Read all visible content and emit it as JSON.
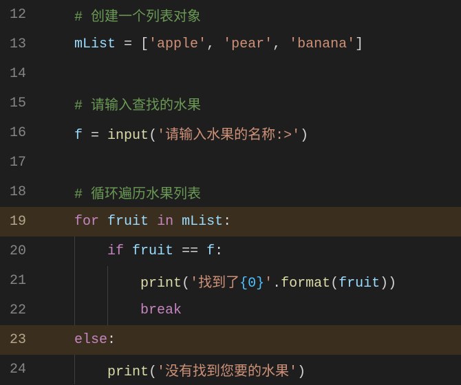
{
  "lines": [
    {
      "num": "12",
      "hl": false,
      "indent": "    ",
      "guides": [],
      "tokens": [
        {
          "t": "# 创建一个列表对象",
          "c": "c-comment"
        }
      ]
    },
    {
      "num": "13",
      "hl": false,
      "indent": "    ",
      "guides": [],
      "tokens": [
        {
          "t": "mList",
          "c": "c-var"
        },
        {
          "t": " = [",
          "c": "c-punc"
        },
        {
          "t": "'apple'",
          "c": "c-string"
        },
        {
          "t": ", ",
          "c": "c-punc"
        },
        {
          "t": "'pear'",
          "c": "c-string"
        },
        {
          "t": ", ",
          "c": "c-punc"
        },
        {
          "t": "'banana'",
          "c": "c-string"
        },
        {
          "t": "]",
          "c": "c-punc"
        }
      ]
    },
    {
      "num": "14",
      "hl": false,
      "indent": "",
      "guides": [],
      "tokens": []
    },
    {
      "num": "15",
      "hl": false,
      "indent": "    ",
      "guides": [],
      "tokens": [
        {
          "t": "# 请输入查找的水果",
          "c": "c-comment"
        }
      ]
    },
    {
      "num": "16",
      "hl": false,
      "indent": "    ",
      "guides": [],
      "tokens": [
        {
          "t": "f",
          "c": "c-var"
        },
        {
          "t": " = ",
          "c": "c-op"
        },
        {
          "t": "input",
          "c": "c-func"
        },
        {
          "t": "(",
          "c": "c-punc"
        },
        {
          "t": "'请输入水果的名称:>'",
          "c": "c-string"
        },
        {
          "t": ")",
          "c": "c-punc"
        }
      ]
    },
    {
      "num": "17",
      "hl": false,
      "indent": "",
      "guides": [],
      "tokens": []
    },
    {
      "num": "18",
      "hl": false,
      "indent": "    ",
      "guides": [],
      "tokens": [
        {
          "t": "# 循环遍历水果列表",
          "c": "c-comment"
        }
      ]
    },
    {
      "num": "19",
      "hl": true,
      "indent": "    ",
      "guides": [],
      "tokens": [
        {
          "t": "for",
          "c": "c-keyword"
        },
        {
          "t": " ",
          "c": "c-ident"
        },
        {
          "t": "fruit",
          "c": "c-var"
        },
        {
          "t": " ",
          "c": "c-ident"
        },
        {
          "t": "in",
          "c": "c-keyword"
        },
        {
          "t": " ",
          "c": "c-ident"
        },
        {
          "t": "mList",
          "c": "c-var"
        },
        {
          "t": ":",
          "c": "c-punc"
        }
      ]
    },
    {
      "num": "20",
      "hl": false,
      "indent": "        ",
      "guides": [
        1
      ],
      "tokens": [
        {
          "t": "if",
          "c": "c-keyword"
        },
        {
          "t": " ",
          "c": "c-ident"
        },
        {
          "t": "fruit",
          "c": "c-var"
        },
        {
          "t": " == ",
          "c": "c-op"
        },
        {
          "t": "f",
          "c": "c-var"
        },
        {
          "t": ":",
          "c": "c-punc"
        }
      ]
    },
    {
      "num": "21",
      "hl": false,
      "indent": "            ",
      "guides": [
        1,
        2
      ],
      "tokens": [
        {
          "t": "print",
          "c": "c-func"
        },
        {
          "t": "(",
          "c": "c-punc"
        },
        {
          "t": "'找到了",
          "c": "c-string"
        },
        {
          "t": "{0}",
          "c": "c-brace"
        },
        {
          "t": "'",
          "c": "c-string"
        },
        {
          "t": ".",
          "c": "c-punc"
        },
        {
          "t": "format",
          "c": "c-func"
        },
        {
          "t": "(",
          "c": "c-punc"
        },
        {
          "t": "fruit",
          "c": "c-var"
        },
        {
          "t": "))",
          "c": "c-punc"
        }
      ]
    },
    {
      "num": "22",
      "hl": false,
      "indent": "            ",
      "guides": [
        1,
        2
      ],
      "tokens": [
        {
          "t": "break",
          "c": "c-keyword"
        }
      ]
    },
    {
      "num": "23",
      "hl": true,
      "indent": "    ",
      "guides": [],
      "tokens": [
        {
          "t": "else",
          "c": "c-keyword"
        },
        {
          "t": ":",
          "c": "c-punc"
        }
      ]
    },
    {
      "num": "24",
      "hl": false,
      "indent": "        ",
      "guides": [
        1
      ],
      "tokens": [
        {
          "t": "print",
          "c": "c-func"
        },
        {
          "t": "(",
          "c": "c-punc"
        },
        {
          "t": "'没有找到您要的水果'",
          "c": "c-string"
        },
        {
          "t": ")",
          "c": "c-punc"
        }
      ]
    }
  ],
  "indentWidth": 48,
  "gutterWidth": 60
}
